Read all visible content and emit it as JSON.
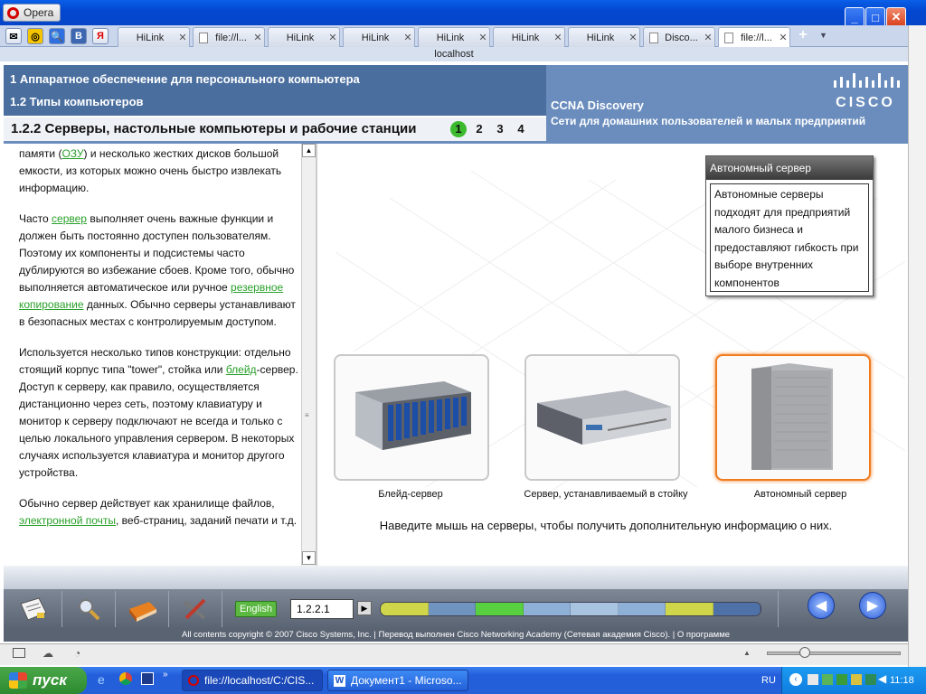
{
  "browser": {
    "menu_label": "Opera",
    "address": "localhost",
    "tabs": [
      {
        "label": "HiLink",
        "doc": false
      },
      {
        "label": "file://l...",
        "doc": true
      },
      {
        "label": "HiLink",
        "doc": false
      },
      {
        "label": "HiLink",
        "doc": false
      },
      {
        "label": "HiLink",
        "doc": false
      },
      {
        "label": "HiLink",
        "doc": false
      },
      {
        "label": "HiLink",
        "doc": false
      },
      {
        "label": "Disco...",
        "doc": true
      },
      {
        "label": "file://l...",
        "doc": true,
        "active": true
      }
    ],
    "quick_buttons": [
      "✉",
      "◎",
      "🔍",
      "В",
      "Я"
    ],
    "window_buttons": {
      "min": "_",
      "max": "□",
      "close": "✕"
    }
  },
  "header": {
    "chapter": "1 Аппаратное обеспечение для персонального компьютера",
    "subchapter": "1.2 Типы компьютеров",
    "section": "1.2.2 Серверы, настольные компьютеры и рабочие станции",
    "pages": [
      "1",
      "2",
      "3",
      "4"
    ],
    "current_page": "1",
    "course": "CCNA Discovery",
    "course_sub": "Сети для домашних пользователей и малых предприятий",
    "logo_text": "CISCO"
  },
  "text": {
    "p1": {
      "a": "памяти (",
      "link": "ОЗУ",
      "b": ") и несколько жестких дисков большой емкости, из которых можно очень быстро извлекать информацию."
    },
    "p2": {
      "a": "Часто ",
      "link1": "сервер",
      "b": " выполняет очень важные функции и должен быть постоянно доступен пользователям. Поэтому их компоненты и подсистемы часто дублируются во избежание сбоев. Кроме того, обычно выполняется автоматическое или ручное ",
      "link2": "резервное копирование",
      "c": " данных. Обычно серверы устанавливают в безопасных местах с контролируемым доступом."
    },
    "p3": {
      "a": "Используется несколько типов конструкции: отдельно стоящий корпус типа \"tower\", стойка или ",
      "link": "блейд",
      "b": "-сервер. Доступ к серверу, как правило, осуществляется дистанционно через сеть, поэтому клавиатуру и монитор к серверу подключают не всегда и только с целью локального управления сервером. В некоторых случаях используется клавиатура и монитор другого устройства."
    },
    "p4": {
      "a": "Обычно сервер действует как хранилище файлов, ",
      "link": "электронной почты",
      "b": ", веб-страниц, заданий печати и т.д."
    }
  },
  "tooltip": {
    "title": "Автономный сервер",
    "body": "Автономные серверы подходят для предприятий малого бизнеса и предоставляют гибкость при выборе внутренних компонентов"
  },
  "servers": [
    {
      "caption": "Блейд-сервер",
      "selected": false
    },
    {
      "caption": "Сервер, устанавливаемый в стойку",
      "selected": false
    },
    {
      "caption": "Автономный сервер",
      "selected": true
    }
  ],
  "hint": "Наведите мышь на серверы, чтобы получить дополнительную информацию о них.",
  "toolbar": {
    "language": "English",
    "page_field": "1.2.2.1",
    "progress_colors": [
      "#cfd64a",
      "#6f94bf",
      "#58d040",
      "#8fb0d6",
      "#a9c4e0",
      "#8fb0d6",
      "#cfd64a",
      "#4e71a8"
    ],
    "prev": "◀",
    "next": "▶",
    "copyright": "All contents copyright © 2007 Cisco Systems, Inc. | Перевод выполнен Cisco Networking Academy (Сетевая академия Cisco). | О программе"
  },
  "taskbar": {
    "start": "пуск",
    "tasks": [
      "file://localhost/C:/CIS...",
      "Документ1 - Microso..."
    ],
    "lang": "RU",
    "time": "11:18"
  },
  "colors": {
    "cisco_blue": "#4a6f9f",
    "accent_green": "#3dbb2e",
    "link_green": "#2aa02a",
    "selected_orange": "#f07c20"
  }
}
